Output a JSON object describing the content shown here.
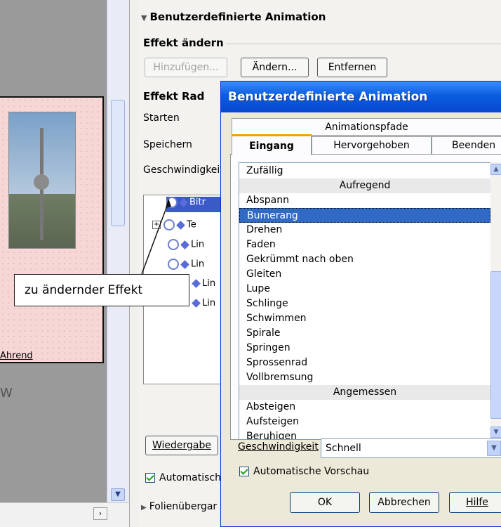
{
  "slide": {
    "label": "Ahrend",
    "partial_text": "W"
  },
  "pane": {
    "title": "Benutzerdefinierte Animation",
    "section_change": "Effekt ändern",
    "btn_add": "Hinzufügen...",
    "btn_change": "Ändern...",
    "btn_remove": "Entfernen",
    "section_effect": "Effekt Rad",
    "label_start": "Starten",
    "label_save": "Speichern",
    "label_speed": "Geschwindigkeit",
    "effects": [
      {
        "text": "Bitr",
        "expand": false
      },
      {
        "text": "Te",
        "expand": true
      },
      {
        "text": "Lin",
        "expand": false
      },
      {
        "text": "Lin",
        "expand": false
      },
      {
        "text": "Lin",
        "expand": false
      },
      {
        "text": "Lin",
        "expand": false
      }
    ],
    "btn_play": "Wiedergabe",
    "auto_preview": "Automatisch",
    "transitions": "Folienübergar"
  },
  "callout": "zu ändernder Effekt",
  "dialog": {
    "title": "Benutzerdefinierte Animation",
    "tab_paths": "Animationspfade",
    "tab_entrance": "Eingang",
    "tab_emphasis": "Hervorgehoben",
    "tab_exit": "Beenden",
    "list": [
      {
        "text": "Zufällig",
        "kind": "item"
      },
      {
        "text": "Aufregend",
        "kind": "group"
      },
      {
        "text": "Abspann",
        "kind": "item"
      },
      {
        "text": "Bumerang",
        "kind": "selected"
      },
      {
        "text": "Drehen",
        "kind": "item"
      },
      {
        "text": "Faden",
        "kind": "item"
      },
      {
        "text": "Gekrümmt nach oben",
        "kind": "item"
      },
      {
        "text": "Gleiten",
        "kind": "item"
      },
      {
        "text": "Lupe",
        "kind": "item"
      },
      {
        "text": "Schlinge",
        "kind": "item"
      },
      {
        "text": "Schwimmen",
        "kind": "item"
      },
      {
        "text": "Spirale",
        "kind": "item"
      },
      {
        "text": "Springen",
        "kind": "item"
      },
      {
        "text": "Sprossenrad",
        "kind": "item"
      },
      {
        "text": "Vollbremsung",
        "kind": "item"
      },
      {
        "text": "Angemessen",
        "kind": "group"
      },
      {
        "text": "Absteigen",
        "kind": "item"
      },
      {
        "text": "Aufsteigen",
        "kind": "item"
      },
      {
        "text": "Beruhigen",
        "kind": "item"
      }
    ],
    "speed_label": "Geschwindigkeit",
    "speed_value": "Schnell",
    "auto_preview": "Automatische Vorschau",
    "btn_ok": "OK",
    "btn_cancel": "Abbrechen",
    "btn_help": "Hilfe"
  },
  "colors": {
    "title_bar": "#0a5de0",
    "selection": "#316ac5",
    "slide_bg": "#f7d6d6"
  }
}
